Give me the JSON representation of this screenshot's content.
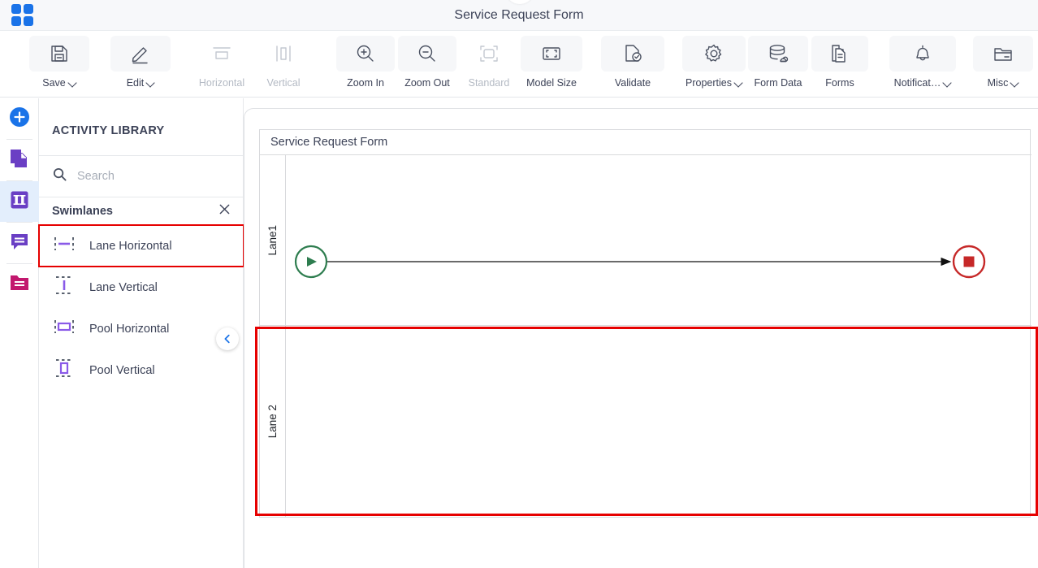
{
  "window": {
    "title": "Service Request Form",
    "logo_icon": "app-grid-icon"
  },
  "toolbar": {
    "items": [
      {
        "label": "Save",
        "icon": "save-disk-icon",
        "caret": true,
        "disabled": false
      },
      {
        "label": "Edit",
        "icon": "pencil-icon",
        "caret": true,
        "disabled": false
      },
      {
        "label": "Horizontal",
        "icon": "align-horizontal-icon",
        "caret": false,
        "disabled": true
      },
      {
        "label": "Vertical",
        "icon": "align-vertical-icon",
        "caret": false,
        "disabled": true
      },
      {
        "label": "Zoom In",
        "icon": "zoom-in-icon",
        "caret": false,
        "disabled": false
      },
      {
        "label": "Zoom Out",
        "icon": "zoom-out-icon",
        "caret": false,
        "disabled": false
      },
      {
        "label": "Standard",
        "icon": "fit-standard-icon",
        "caret": false,
        "disabled": true
      },
      {
        "label": "Model Size",
        "icon": "model-size-icon",
        "caret": false,
        "disabled": false
      },
      {
        "label": "Validate",
        "icon": "validate-check-icon",
        "caret": false,
        "disabled": false
      },
      {
        "label": "Properties",
        "icon": "gear-icon",
        "caret": true,
        "disabled": false
      },
      {
        "label": "Form Data",
        "icon": "database-icon",
        "caret": false,
        "disabled": false
      },
      {
        "label": "Forms",
        "icon": "document-icon",
        "caret": false,
        "disabled": false
      },
      {
        "label": "Notificat…",
        "icon": "bell-icon",
        "caret": true,
        "disabled": false
      },
      {
        "label": "Misc",
        "icon": "folder-icon",
        "caret": true,
        "disabled": false
      }
    ]
  },
  "rail": {
    "items": [
      {
        "name": "add-button",
        "icon": "plus-circle-icon",
        "active": false
      },
      {
        "name": "pages-button",
        "icon": "copy-pages-icon",
        "active": false
      },
      {
        "name": "swimlanes-button",
        "icon": "swimlane-icon",
        "active": true
      },
      {
        "name": "comments-button",
        "icon": "comment-icon",
        "active": false
      },
      {
        "name": "documents-button",
        "icon": "folder-doc-icon",
        "active": false
      }
    ]
  },
  "panel": {
    "title": "ACTIVITY LIBRARY",
    "search": {
      "value": "",
      "placeholder": "Search",
      "icon": "search-icon"
    },
    "group": {
      "label": "Swimlanes",
      "close_icon": "close-icon"
    },
    "items": [
      {
        "label": "Lane Horizontal",
        "icon": "lane-horizontal-icon",
        "selected": true
      },
      {
        "label": "Lane Vertical",
        "icon": "lane-vertical-icon",
        "selected": false
      },
      {
        "label": "Pool Horizontal",
        "icon": "pool-horizontal-icon",
        "selected": false
      },
      {
        "label": "Pool Vertical",
        "icon": "pool-vertical-icon",
        "selected": false
      }
    ],
    "collapse_icon": "chevron-left-icon"
  },
  "canvas": {
    "pool_title": "Service Request Form",
    "lanes": [
      {
        "label": "Lane1",
        "highlighted": false
      },
      {
        "label": "Lane 2",
        "highlighted": true
      }
    ],
    "nodes": [
      {
        "name": "start-event",
        "type": "start",
        "label": ""
      },
      {
        "name": "end-event",
        "type": "end",
        "label": ""
      }
    ]
  },
  "colors": {
    "brand_blue": "#1a73e8",
    "accent_purple": "#7b4fd6",
    "accent_magenta": "#c2186e",
    "highlight_red": "#e60000",
    "start_green": "#2e7d4f",
    "end_red": "#c62828",
    "text": "#3c4257"
  }
}
